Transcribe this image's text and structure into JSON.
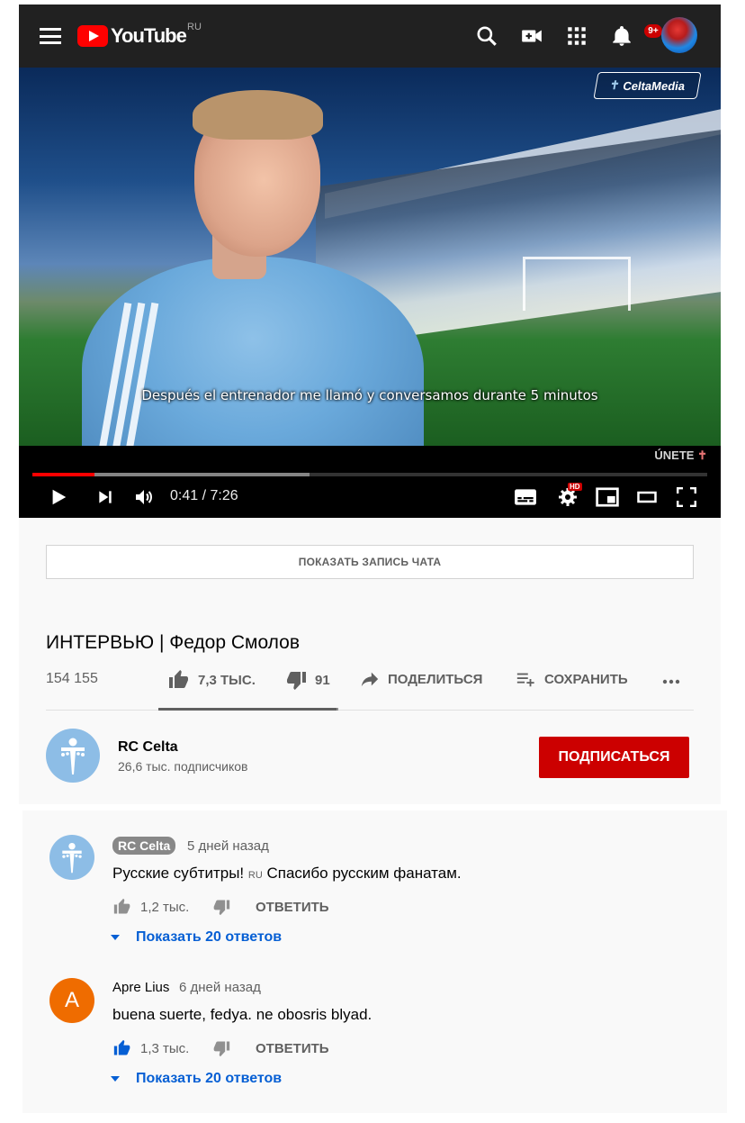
{
  "header": {
    "logo_text": "YouTube",
    "region": "RU",
    "notifications_badge": "9+",
    "icons": [
      "menu-icon",
      "search-icon",
      "create-video-icon",
      "apps-icon",
      "bell-icon"
    ]
  },
  "player": {
    "watermark": "CeltaMedia",
    "subtitle": "Después el entrenador me llamó y conversamos durante 5 minutos",
    "join_label": "ÚNETE",
    "time_current": "0:41",
    "time_separator": " / ",
    "time_total": "7:26",
    "progress_played": 0.092,
    "progress_buffered": 0.41,
    "hd_badge": "HD"
  },
  "chat": {
    "button_label": "ПОКАЗАТЬ ЗАПИСЬ ЧАТА"
  },
  "video": {
    "title": "ИНТЕРВЬЮ | Федор Смолов",
    "views": "154 155",
    "likes": "7,3 ТЫС.",
    "dislikes": "91",
    "share_label": "ПОДЕЛИТЬСЯ",
    "save_label": "СОХРАНИТЬ",
    "like_ratio": 0.988
  },
  "channel": {
    "name": "RC Celta",
    "subscribers": "26,6 тыс. подписчиков",
    "subscribe_label": "ПОДПИСАТЬСЯ"
  },
  "comments": [
    {
      "author": "RC Celta",
      "is_owner": true,
      "time": "5 дней назад",
      "text_before": "Русские субтитры! ",
      "flag": "RU",
      "text_after": " Спасибо русским фанатам.",
      "likes": "1,2 тыс.",
      "reply_label": "ОТВЕТИТЬ",
      "show_replies": "Показать 20 ответов"
    },
    {
      "author": "Apre Lius",
      "avatar_letter": "A",
      "avatar_color": "#ef6c00",
      "time": "6 дней назад",
      "text": "buena suerte, fedya. ne obosris blyad.",
      "likes": "1,3 тыс.",
      "liked": true,
      "reply_label": "ОТВЕТИТЬ",
      "show_replies": "Показать 20 ответов"
    }
  ],
  "colors": {
    "brand_red": "#ff0000",
    "subscribe_red": "#cc0000",
    "link_blue": "#065fd4",
    "channel_avatar": "#8dbde6"
  }
}
